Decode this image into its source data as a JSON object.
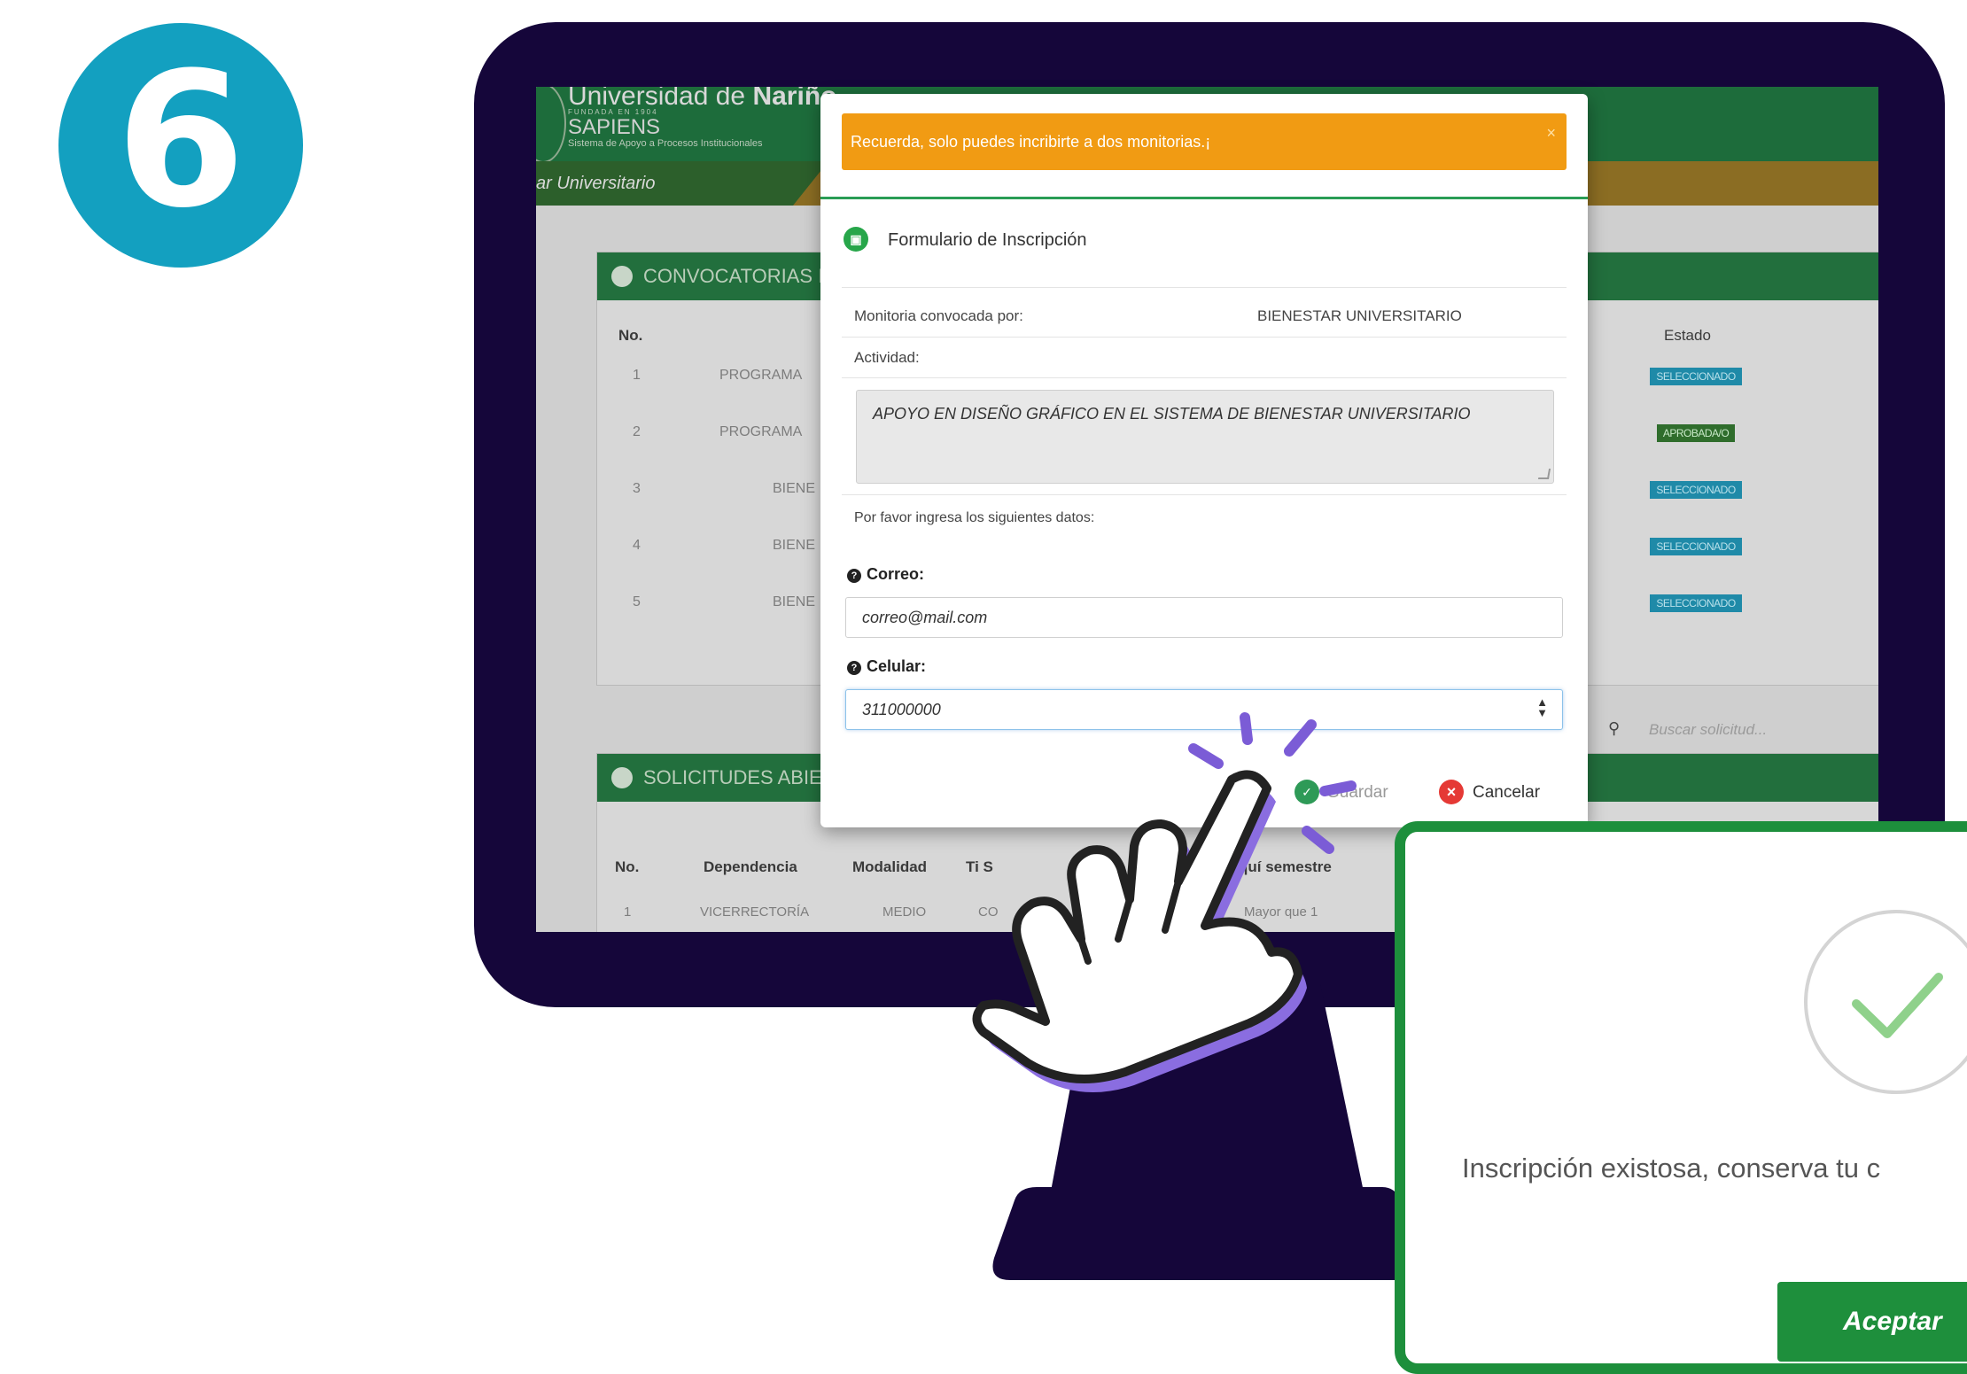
{
  "step": {
    "number": "6"
  },
  "colors": {
    "frame": "#15063a",
    "brand_green": "#1d8f3c",
    "alert_orange": "#f19b13",
    "badge_teal": "#13a0c0"
  },
  "background_page": {
    "university_name": "Universidad de ",
    "university_name_bold": "Nariño",
    "founded": "FUNDADA EN 1904",
    "app_name": "SAPIENS",
    "app_subtitle": "Sistema de Apoyo a Procesos Institucionales",
    "breadcrumb": "ar Universitario",
    "panel1_title": "CONVOCATORIAS II",
    "panel1_columns": {
      "no": "No.",
      "estado": "Estado"
    },
    "panel1_rows": [
      {
        "no": "1",
        "dep": "PROGRAMA",
        "estado": "SELECCIONADO"
      },
      {
        "no": "2",
        "dep": "PROGRAMA",
        "estado": "APROBADA/O"
      },
      {
        "no": "3",
        "dep": "BIENE",
        "estado": "SELECCIONADO"
      },
      {
        "no": "4",
        "dep": "BIENE",
        "estado": "SELECCIONADO"
      },
      {
        "no": "5",
        "dep": "BIENE",
        "estado": "SELECCIONADO"
      }
    ],
    "search_placeholder": "Buscar solicitud...",
    "panel2_title": "SOLICITUDES ABIE",
    "panel2_columns": {
      "no": "No.",
      "dependencia": "Dependencia",
      "modalidad": "Modalidad",
      "tipo": "Ti S",
      "semestre": "quí semestre"
    },
    "panel2_row": {
      "no": "1",
      "dependencia": "VICERRECTORÍA",
      "modalidad": "MEDIO",
      "tipo": "CO",
      "semestre": "Mayor que 1"
    }
  },
  "modal": {
    "alert": "Recuerda, solo puedes incribirte a dos monitorias.¡",
    "alert_close": "×",
    "title": "Formulario de Inscripción",
    "convocada_label": "Monitoria convocada por:",
    "convocada_value": "BIENESTAR UNIVERSITARIO",
    "actividad_label": "Actividad:",
    "actividad_value": "APOYO EN DISEÑO GRÁFICO EN EL SISTEMA DE BIENESTAR UNIVERSITARIO",
    "instructions": "Por favor ingresa los siguientes datos:",
    "correo_label": "Correo:",
    "correo_value": "correo@mail.com",
    "celular_label": "Celular:",
    "celular_value": "311000000",
    "save_label": "Guardar",
    "cancel_label": "Cancelar"
  },
  "success_dialog": {
    "message": "Inscripción existosa, conserva tu c",
    "accept_label": "Aceptar"
  }
}
